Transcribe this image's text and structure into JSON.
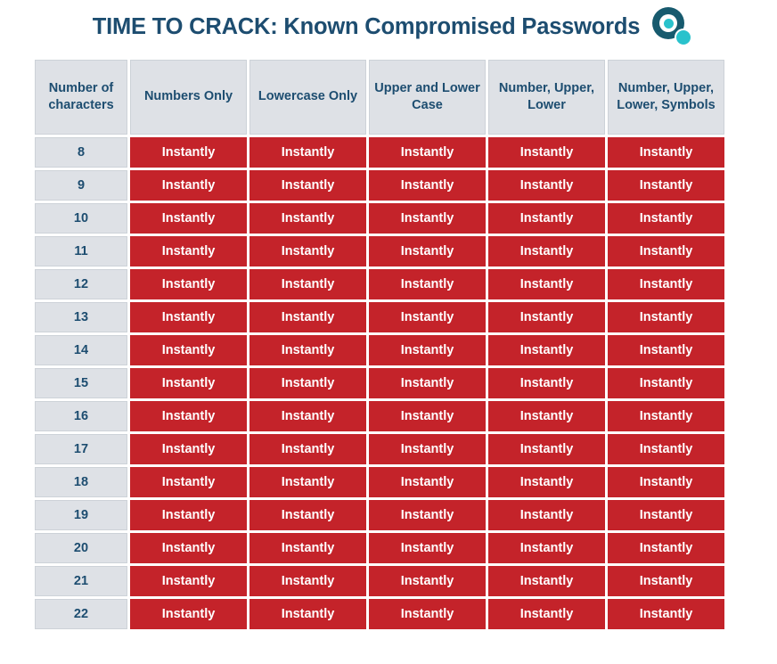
{
  "header": {
    "title": "TIME TO CRACK: Known Compromised Passwords",
    "logo_name": "brand-logo",
    "title_color": "#1d4d70"
  },
  "colors": {
    "title": "#1d4d70",
    "header_cell_bg": "#dee1e6",
    "header_cell_border": "#cdd2d8",
    "value_cell_bg": "#c4232a",
    "value_cell_text": "#ffffff",
    "page_bg": "#ffffff",
    "logo_dark": "#175a6e",
    "logo_accent": "#29c2cc"
  },
  "chart_data": {
    "type": "table",
    "title": "TIME TO CRACK: Known Compromised Passwords",
    "categories": [
      "Number of characters",
      "Numbers Only",
      "Lowercase Only",
      "Upper and Lower Case",
      "Number, Upper, Lower",
      "Number, Upper, Lower, Symbols"
    ],
    "rows": [
      {
        "chars": "8",
        "values": [
          "Instantly",
          "Instantly",
          "Instantly",
          "Instantly",
          "Instantly"
        ]
      },
      {
        "chars": "9",
        "values": [
          "Instantly",
          "Instantly",
          "Instantly",
          "Instantly",
          "Instantly"
        ]
      },
      {
        "chars": "10",
        "values": [
          "Instantly",
          "Instantly",
          "Instantly",
          "Instantly",
          "Instantly"
        ]
      },
      {
        "chars": "11",
        "values": [
          "Instantly",
          "Instantly",
          "Instantly",
          "Instantly",
          "Instantly"
        ]
      },
      {
        "chars": "12",
        "values": [
          "Instantly",
          "Instantly",
          "Instantly",
          "Instantly",
          "Instantly"
        ]
      },
      {
        "chars": "13",
        "values": [
          "Instantly",
          "Instantly",
          "Instantly",
          "Instantly",
          "Instantly"
        ]
      },
      {
        "chars": "14",
        "values": [
          "Instantly",
          "Instantly",
          "Instantly",
          "Instantly",
          "Instantly"
        ]
      },
      {
        "chars": "15",
        "values": [
          "Instantly",
          "Instantly",
          "Instantly",
          "Instantly",
          "Instantly"
        ]
      },
      {
        "chars": "16",
        "values": [
          "Instantly",
          "Instantly",
          "Instantly",
          "Instantly",
          "Instantly"
        ]
      },
      {
        "chars": "17",
        "values": [
          "Instantly",
          "Instantly",
          "Instantly",
          "Instantly",
          "Instantly"
        ]
      },
      {
        "chars": "18",
        "values": [
          "Instantly",
          "Instantly",
          "Instantly",
          "Instantly",
          "Instantly"
        ]
      },
      {
        "chars": "19",
        "values": [
          "Instantly",
          "Instantly",
          "Instantly",
          "Instantly",
          "Instantly"
        ]
      },
      {
        "chars": "20",
        "values": [
          "Instantly",
          "Instantly",
          "Instantly",
          "Instantly",
          "Instantly"
        ]
      },
      {
        "chars": "21",
        "values": [
          "Instantly",
          "Instantly",
          "Instantly",
          "Instantly",
          "Instantly"
        ]
      },
      {
        "chars": "22",
        "values": [
          "Instantly",
          "Instantly",
          "Instantly",
          "Instantly",
          "Instantly"
        ]
      }
    ],
    "legend": [],
    "xlabel": "",
    "ylabel": ""
  }
}
